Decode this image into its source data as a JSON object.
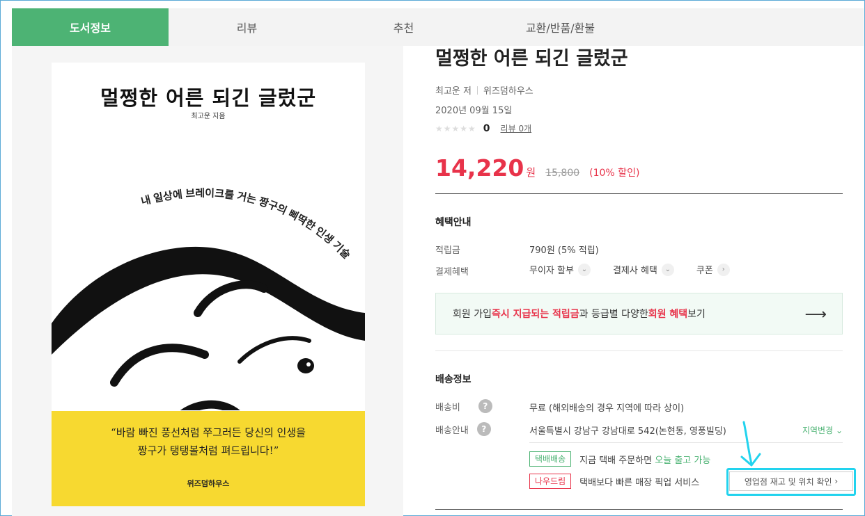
{
  "tabs": [
    {
      "label": "도서정보",
      "active": true
    },
    {
      "label": "리뷰",
      "active": false
    },
    {
      "label": "추천",
      "active": false
    },
    {
      "label": "교환/반품/환불",
      "active": false
    }
  ],
  "cover": {
    "title": "멀쩡한 어른 되긴 글렀군",
    "author": "최고운 지음",
    "tagline": "내 일상에 브레이크를 거는 짱구의 삐딱한 인생 기술",
    "quote_line1": "“바람 빠진 풍선처럼 쭈그러든 당신의 인생을",
    "quote_line2": "짱구가 탱탱볼처럼 펴드립니다!”",
    "publisher": "위즈덤하우스"
  },
  "book": {
    "title": "멀쩡한 어른 되긴 글렀군",
    "author": "최고운 저",
    "publisher": "위즈덤하우스",
    "date": "2020년 09월 15일",
    "stars": "★★★★★",
    "score": "0",
    "review_link": "리뷰 0개"
  },
  "price": {
    "sale": "14,220",
    "unit": "원",
    "original": "15,800",
    "discount": "(10% 할인)"
  },
  "benefits": {
    "title": "혜택안내",
    "points_label": "적립금",
    "points_value": "790원  (5% 적립)",
    "payment_label": "결제혜택",
    "opt1": "무이자 할부",
    "opt2": "결제사 혜택",
    "opt3": "쿠폰"
  },
  "member": {
    "t1": "회원 가입 ",
    "t2": "즉시 지급되는 적립금",
    "t3": " 과 등급별 다양한 ",
    "t4": "회원 혜택",
    "t5": " 보기"
  },
  "shipping": {
    "title": "배송정보",
    "fee_label": "배송비",
    "fee_value": "무료  (해외배송의 경우 지역에 따라 상이)",
    "guide_label": "배송안내",
    "address": "서울특별시 강남구 강남대로 542(논현동, 영풍빌딩)",
    "region_change": "지역변경",
    "badge1": "택배배송",
    "line1_a": "지금 택배 주문하면 ",
    "line1_b": "오늘 출고 가능",
    "badge2": "나우드림",
    "line2": "택배보다 빠른 매장 픽업 서비스",
    "store_button": "영업점 재고 및 위치 확인"
  },
  "colors": {
    "accent": "#4db374",
    "price_red": "#e8334a",
    "annotation": "#22d3ee"
  }
}
